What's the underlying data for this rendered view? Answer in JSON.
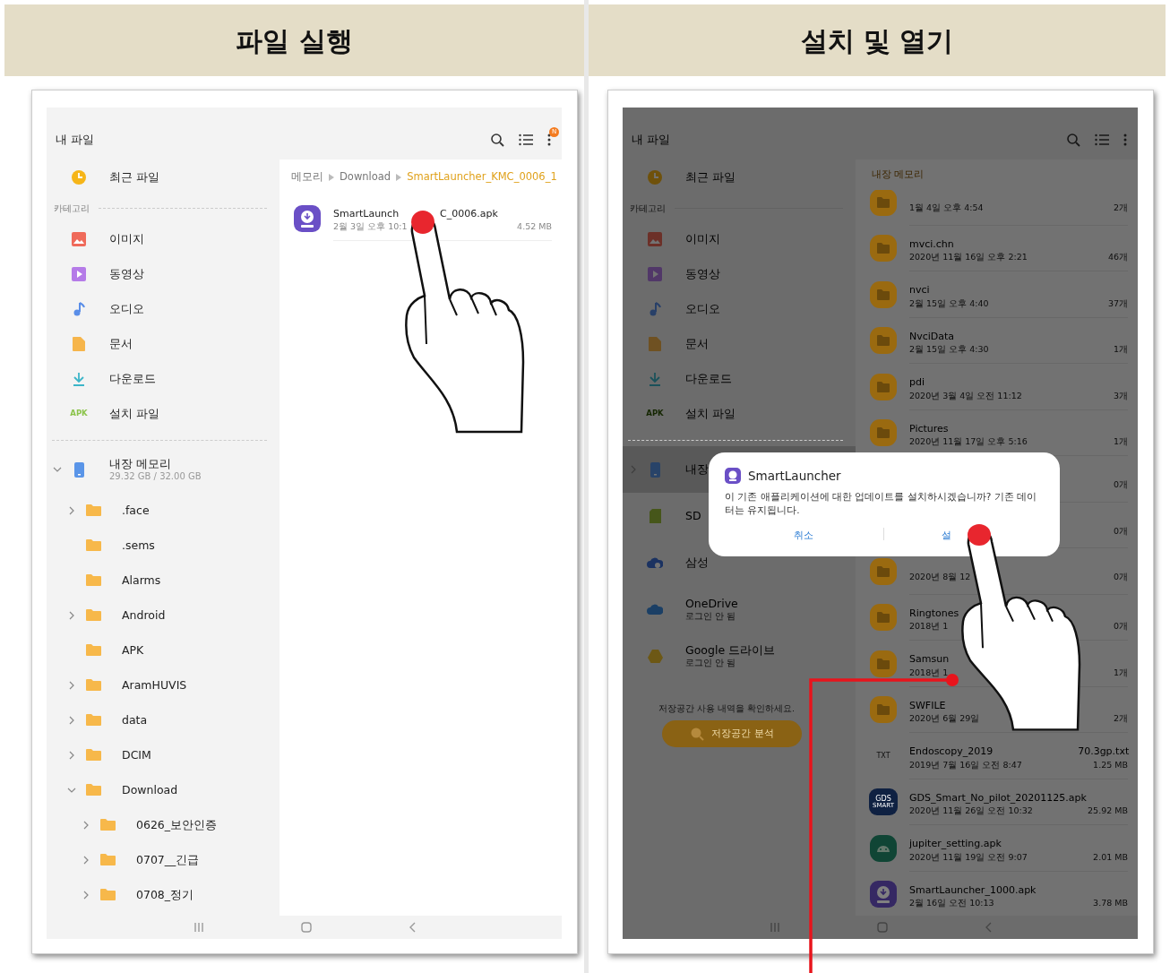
{
  "panels": [
    {
      "heading": "파일 실행",
      "screen": {
        "app_title": "내 파일",
        "badge": "N",
        "dimmed": false,
        "pointer_hand": true,
        "sidebar": {
          "top_items": [
            {
              "kind": "recent",
              "label": "최근 파일"
            }
          ],
          "section_label": "카테고리",
          "categories": [
            {
              "kind": "image",
              "label": "이미지"
            },
            {
              "kind": "video",
              "label": "동영상"
            },
            {
              "kind": "audio",
              "label": "오디오"
            },
            {
              "kind": "document",
              "label": "문서"
            },
            {
              "kind": "download",
              "label": "다운로드"
            },
            {
              "kind": "apk",
              "icon_text": "APK",
              "label": "설치 파일"
            }
          ],
          "storage": [
            {
              "kind": "phone",
              "label": "내장 메모리",
              "detail": "29.32 GB / 32.00 GB",
              "expanded": true,
              "selected": false,
              "children": [
                {
                  "label": ".face",
                  "expanded": false
                },
                {
                  "label": ".sems"
                },
                {
                  "label": "Alarms"
                },
                {
                  "label": "Android",
                  "expanded": false
                },
                {
                  "label": "APK"
                },
                {
                  "label": "AramHUVIS",
                  "expanded": false
                },
                {
                  "label": "data",
                  "expanded": false
                },
                {
                  "label": "DCIM",
                  "expanded": false
                },
                {
                  "label": "Download",
                  "expanded": true,
                  "children": [
                    {
                      "label": "0626_보안인증",
                      "expanded": false
                    },
                    {
                      "label": "0707__긴급",
                      "expanded": false
                    },
                    {
                      "label": "0708_정기",
                      "expanded": false
                    }
                  ]
                }
              ]
            }
          ]
        },
        "content": {
          "breadcrumb": [
            {
              "label": "메모리",
              "selected": false
            },
            {
              "label": "Download",
              "selected": false
            },
            {
              "label": "SmartLauncher_KMC_0006_1",
              "selected": true
            }
          ],
          "files": [
            {
              "kind": "apk_launcher",
              "name": "SmartLaunch",
              "name_end": "C_0006.apk",
              "date": "2월 3일 오후 10:1",
              "size": "4.52 MB"
            }
          ]
        }
      }
    },
    {
      "heading": "설치 및 열기",
      "callout": true,
      "screen": {
        "app_title": "내 파일",
        "dimmed": true,
        "pointer_hand": true,
        "sidebar": {
          "top_items": [
            {
              "kind": "recent",
              "label": "최근 파일"
            }
          ],
          "section_label": "카테고리",
          "categories": [
            {
              "kind": "image",
              "label": "이미지"
            },
            {
              "kind": "video",
              "label": "동영상"
            },
            {
              "kind": "audio",
              "label": "오디오"
            },
            {
              "kind": "document",
              "label": "문서"
            },
            {
              "kind": "download",
              "label": "다운로드"
            },
            {
              "kind": "apk",
              "icon_text": "APK",
              "label": "설치 파일"
            }
          ],
          "storage": [
            {
              "kind": "phone",
              "label": "내장",
              "expanded": false,
              "selected": true
            },
            {
              "kind": "sd",
              "label": "SD",
              "selected": false
            },
            {
              "kind": "samsung_cloud",
              "label": "삼성",
              "selected": false
            },
            {
              "kind": "onedrive",
              "label": "OneDrive",
              "detail": "로그인 안 됨",
              "selected": false
            },
            {
              "kind": "gdrive",
              "label": "Google 드라이브",
              "detail": "로그인 안 됨",
              "selected": false
            }
          ],
          "storage_hint": "저장공간 사용 내역을 확인하세요.",
          "analyze_button": "저장공간 분석"
        },
        "content": {
          "section_title": "내장 메모리",
          "files": [
            {
              "kind": "folder",
              "date": "1월 4일 오후 4:54",
              "size": "2개"
            },
            {
              "kind": "folder",
              "name": "mvci.chn",
              "date": "2020년 11월 16일 오후 2:21",
              "size": "46개"
            },
            {
              "kind": "folder",
              "name": "nvci",
              "date": "2월 15일 오후 4:40",
              "size": "37개"
            },
            {
              "kind": "folder",
              "name": "NvciData",
              "date": "2월 15일 오후 4:30",
              "size": "1개"
            },
            {
              "kind": "folder",
              "name": "pdi",
              "date": "2020년 3월 4일 오전 11:12",
              "size": "3개"
            },
            {
              "kind": "folder",
              "name": "Pictures",
              "date": "2020년 11월 17일 오후 5:16",
              "size": "1개"
            },
            {
              "kind": "folder",
              "size": "0개"
            },
            {
              "kind": "folder",
              "size": "0개"
            },
            {
              "kind": "folder",
              "date": "2020년 8월 12",
              "size": "0개"
            },
            {
              "kind": "folder",
              "name": "Ringtones",
              "date": "2018년 1",
              "size": "0개"
            },
            {
              "kind": "folder",
              "name": "Samsun",
              "date": "2018년 1",
              "size": "1개"
            },
            {
              "kind": "folder",
              "name": "SWFILE",
              "date": "2020년 6월 29일",
              "size": "2개"
            },
            {
              "kind": "txt",
              "icon_text": "TXT",
              "name": "Endoscopy_2019",
              "name_end": "70.3gp.txt",
              "date": "2019년 7월 16일 오전 8:47",
              "size": "1.25 MB"
            },
            {
              "kind": "apk_gds",
              "icon_text": "GDS",
              "icon_subtext": "SMART",
              "name": "GDS_Smart_No_pilot_20201125.apk",
              "date": "2020년 11월 26일 오전 10:32",
              "size": "25.92 MB"
            },
            {
              "kind": "apk_android",
              "name": "jupiter_setting.apk",
              "date": "2020년 11월 19일 오전 9:07",
              "size": "2.01 MB"
            },
            {
              "kind": "apk_launcher",
              "name": "SmartLauncher_1000.apk",
              "date": "2월 16일 오전 10:13",
              "size": "3.78 MB"
            }
          ]
        },
        "dialog": {
          "title": "SmartLauncher",
          "message": "이 기존 애플리케이션에 대한 업데이트를 설치하시겠습니까? 기존 데이터는 유지됩니다.",
          "cancel": "취소",
          "confirm": "설"
        }
      }
    }
  ]
}
